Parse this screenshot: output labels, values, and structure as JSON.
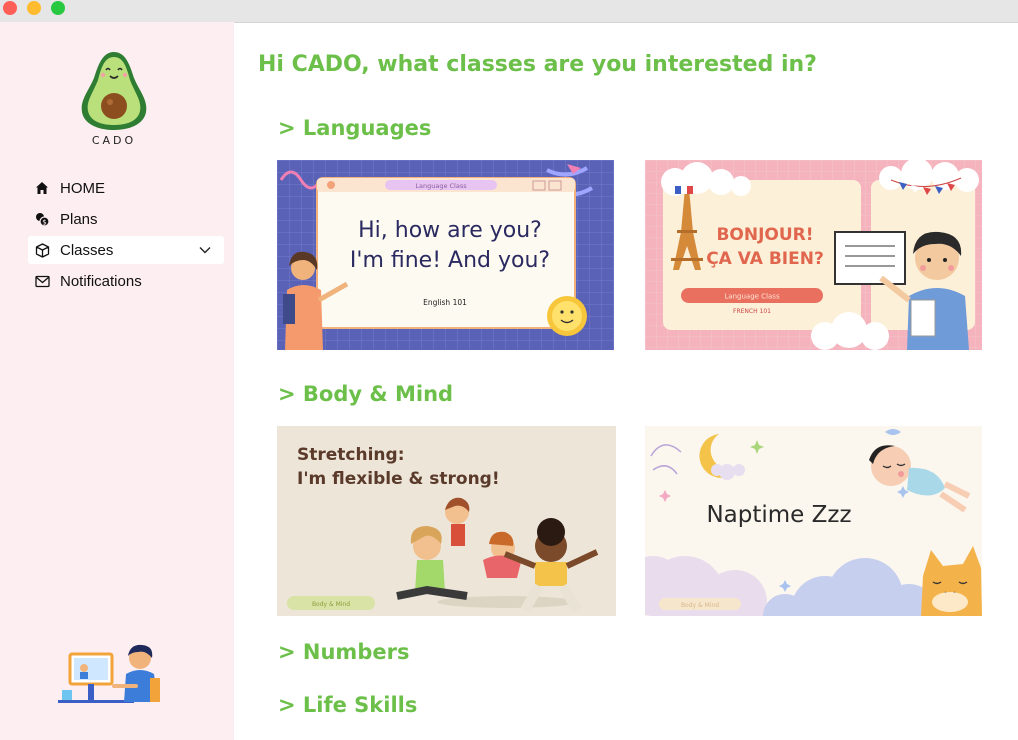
{
  "window": {
    "controls": [
      "close",
      "minimize",
      "maximize"
    ]
  },
  "sidebar": {
    "brand": "CADO",
    "nav": [
      {
        "label": "HOME",
        "icon": "home-icon"
      },
      {
        "label": "Plans",
        "icon": "coins-icon"
      },
      {
        "label": "Classes",
        "icon": "box-icon",
        "active": true,
        "expandable": true
      },
      {
        "label": "Notifications",
        "icon": "envelope-icon"
      }
    ]
  },
  "main": {
    "greeting": "Hi CADO, what classes are you interested in?",
    "sections": [
      {
        "title": "> Languages",
        "cards": [
          {
            "header": "Language Class",
            "line1": "Hi, how are you?",
            "line2": "I'm fine! And you?",
            "caption": "English 101"
          },
          {
            "line1": "BONJOUR!",
            "line2": "ÇA VA BIEN?",
            "pill": "Language Class",
            "caption": "FRENCH 101"
          }
        ]
      },
      {
        "title": "> Body & Mind",
        "cards": [
          {
            "line1": "Stretching:",
            "line2": "I'm flexible & strong!",
            "pill": "Body & Mind"
          },
          {
            "line1": "Naptime Zzz",
            "pill": "Body & Mind"
          }
        ]
      },
      {
        "title": "> Numbers"
      },
      {
        "title": "> Life Skills"
      }
    ]
  },
  "colors": {
    "accent_green": "#6cc04a",
    "sidebar_bg": "#fdeef2",
    "english_card_bg": "#5a62b8",
    "french_card_bg": "#f4b3bd",
    "stretch_card_bg": "#ede6d8",
    "naptime_card_bg": "#fbf6ee"
  }
}
